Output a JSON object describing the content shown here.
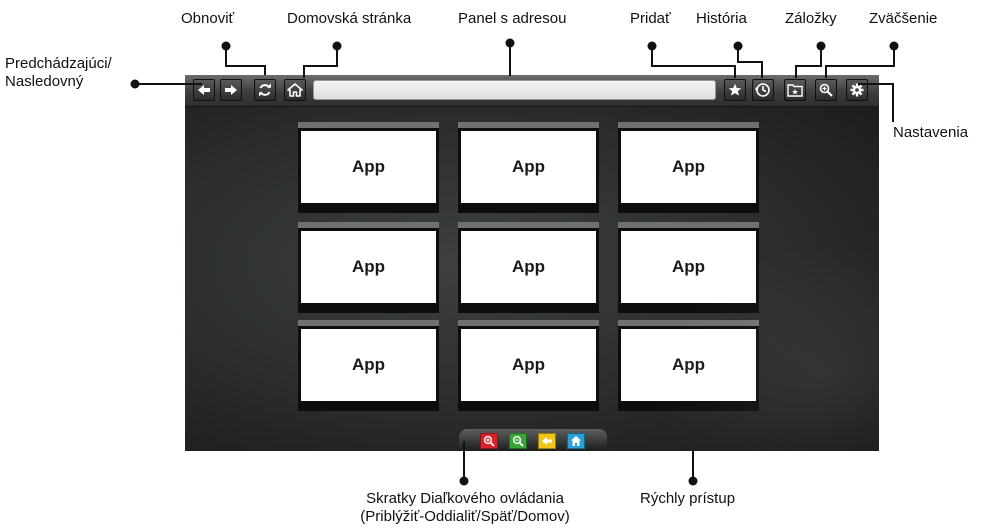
{
  "callouts": {
    "refresh": "Obnoviť",
    "homepage": "Domovská stránka",
    "address_bar": "Panel s adresou",
    "add": "Pridať",
    "history": "História",
    "bookmarks": "Záložky",
    "zoom": "Zväčšenie",
    "prev_next": "Predchádzajúci/ Nasledovný",
    "settings": "Nastavenia",
    "remote_shortcuts_line1": "Skratky Diaľkového ovládania",
    "remote_shortcuts_line2": "(Priblýžiť-Oddialiť/Späť/Domov)",
    "quick_access": "Rýchly prístup"
  },
  "toolbar": {
    "buttons": [
      {
        "name": "back",
        "icon": "arrow-left-icon"
      },
      {
        "name": "forward",
        "icon": "arrow-right-icon"
      },
      {
        "name": "refresh",
        "icon": "refresh-icon"
      },
      {
        "name": "home",
        "icon": "home-icon"
      },
      {
        "name": "add-bookmark",
        "icon": "star-icon"
      },
      {
        "name": "history",
        "icon": "clock-icon"
      },
      {
        "name": "bookmarks",
        "icon": "bookmark-folder-icon"
      },
      {
        "name": "zoom",
        "icon": "magnifier-icon"
      },
      {
        "name": "settings",
        "icon": "gear-icon"
      }
    ],
    "address_value": ""
  },
  "apps": [
    "App",
    "App",
    "App",
    "App",
    "App",
    "App",
    "App",
    "App",
    "App"
  ],
  "quick_access_buttons": [
    {
      "name": "zoom-in",
      "icon": "zoom-in-icon",
      "color": "#d8232a"
    },
    {
      "name": "zoom-out",
      "icon": "zoom-out-icon",
      "color": "#3aa637"
    },
    {
      "name": "back",
      "icon": "back-icon",
      "color": "#f2c417"
    },
    {
      "name": "home",
      "icon": "home-icon",
      "color": "#2a9fd8"
    }
  ]
}
